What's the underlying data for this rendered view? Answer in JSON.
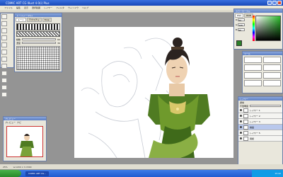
{
  "window": {
    "title": "COMIC ART CG Illust 4.0(i) Plus"
  },
  "menu": {
    "items": [
      "ファイル",
      "編集",
      "表示",
      "選択範囲",
      "レイヤー",
      "フィルタ",
      "ウィンドウ",
      "ヘルプ"
    ]
  },
  "tone_panel": {
    "title": "トーン(ノーマル)",
    "tabs": [
      "トーン",
      "テクスチャ",
      "Tone"
    ],
    "density_label": "線数",
    "density_value": "60",
    "density2_label": "濃度",
    "density2_value": "30"
  },
  "preview_panel": {
    "title": "プレビュー",
    "tabs": [
      "プレビュー",
      "ナビ"
    ]
  },
  "color_panel": {
    "title": "カラーサークル",
    "tabs": [
      "HSV",
      "RGB"
    ],
    "rgb": [
      {
        "label": "R",
        "value": "44"
      },
      {
        "label": "G",
        "value": "125"
      },
      {
        "label": "B",
        "value": "45"
      }
    ]
  },
  "brush_panel": {
    "title": "ツール"
  },
  "layer_panel": {
    "title": "レイヤー",
    "mode": "通常",
    "opacity": "不透明度",
    "layers": [
      {
        "name": "レイヤー 1"
      },
      {
        "name": "レイヤー 2"
      },
      {
        "name": "レイヤー 3"
      },
      {
        "name": "線画"
      },
      {
        "name": "レイヤー 5"
      },
      {
        "name": "用紙"
      }
    ]
  },
  "status": {
    "zoom": "25%",
    "size": "w:1200 × h:1500"
  },
  "taskbar": {
    "tasks": [
      "COMIC ART CG..."
    ],
    "clock": "15:42"
  },
  "colors": {
    "accent": "#2dbd2d",
    "titlebar": "#1848b8",
    "selection": "#b9c8ec"
  }
}
